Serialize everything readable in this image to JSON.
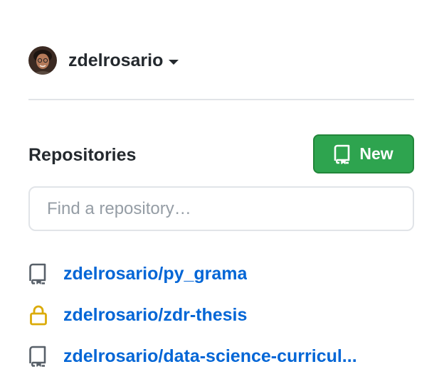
{
  "account": {
    "username": "zdelrosario",
    "avatar_icon": "avatar-photo"
  },
  "repositories": {
    "heading": "Repositories",
    "new_button_label": "New",
    "new_button_icon": "repo-book-icon",
    "search_placeholder": "Find a repository…",
    "search_value": "",
    "items": [
      {
        "name": "zdelrosario/py_grama",
        "icon": "repo-icon"
      },
      {
        "name": "zdelrosario/zdr-thesis",
        "icon": "lock-icon"
      },
      {
        "name": "zdelrosario/data-science-curricul...",
        "icon": "repo-icon"
      }
    ]
  },
  "colors": {
    "link": "#0366d6",
    "new_button_bg": "#2ea44f",
    "lock": "#dbab09",
    "text": "#24292e",
    "divider": "#e1e4e8"
  }
}
